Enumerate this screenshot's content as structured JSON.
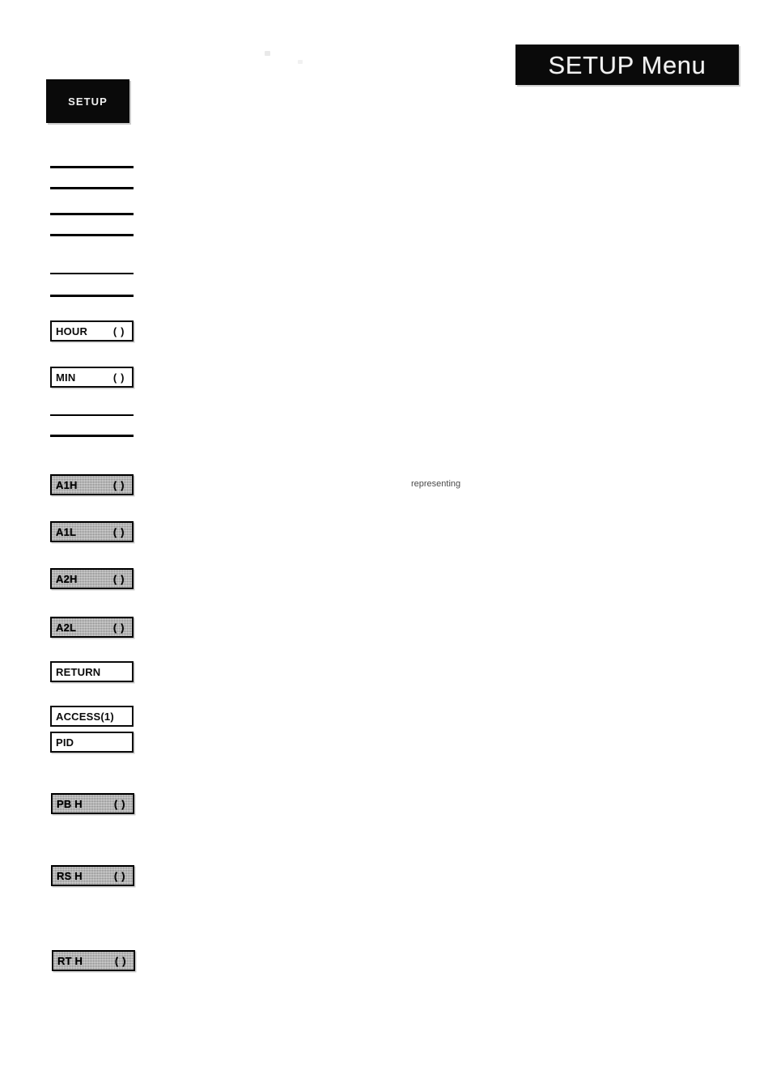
{
  "header": {
    "banner_label": "SETUP Menu"
  },
  "setup_key": {
    "label": "SETUP"
  },
  "menu": {
    "redacted_groups": [
      {
        "name": "group-1",
        "line_count": 4
      },
      {
        "name": "group-2",
        "line_count": 2
      },
      {
        "name": "group-3",
        "line_count": 2
      }
    ],
    "items": [
      {
        "label": "HOUR",
        "value": "( )",
        "style": "white"
      },
      {
        "label": "MIN",
        "value": "( )",
        "style": "white"
      },
      {
        "label": "A1H",
        "value": "( )",
        "style": "gray"
      },
      {
        "label": "A1L",
        "value": "( )",
        "style": "gray"
      },
      {
        "label": "A2H",
        "value": "( )",
        "style": "gray"
      },
      {
        "label": "A2L",
        "value": "( )",
        "style": "gray"
      },
      {
        "label": "RETURN",
        "value": "",
        "style": "white"
      },
      {
        "label": "ACCESS(1)",
        "value": "",
        "style": "white"
      },
      {
        "label": "PID",
        "value": "",
        "style": "white"
      },
      {
        "label": "PB H",
        "value": "( )",
        "style": "gray"
      },
      {
        "label": "RS H",
        "value": "( )",
        "style": "gray"
      },
      {
        "label": "RT H",
        "value": "( )",
        "style": "gray"
      }
    ]
  },
  "body_text": {
    "fragment_representing": "representing"
  },
  "colors": {
    "ink": "#000000",
    "banner_bg": "#0a0a0a",
    "banner_text": "#f2f2f2",
    "gray_fill": "#a9a9a9",
    "page_bg": "#ffffff"
  }
}
